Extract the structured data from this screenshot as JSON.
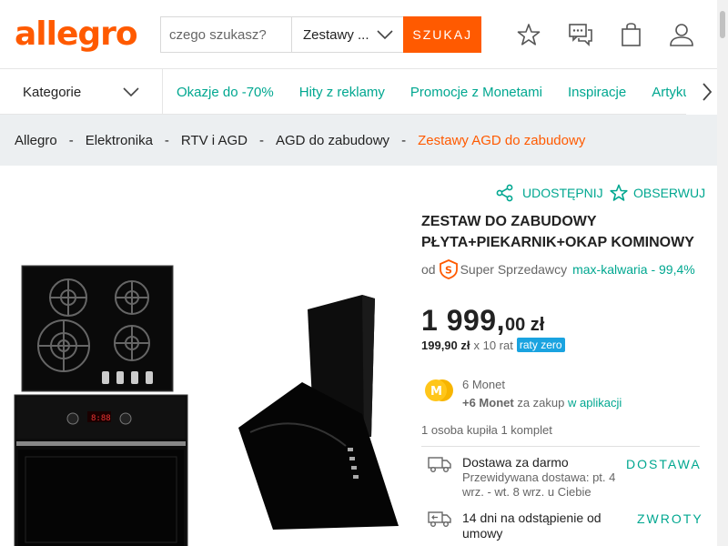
{
  "header": {
    "logo": "allegro",
    "search_placeholder": "czego szukasz?",
    "category_select": "Zestawy ...",
    "search_button": "SZUKAJ"
  },
  "nav": {
    "categories_label": "Kategorie",
    "links": [
      "Okazje do -70%",
      "Hity z reklamy",
      "Promocje z Monetami",
      "Inspiracje",
      "Artykuły"
    ]
  },
  "breadcrumb": {
    "items": [
      "Allegro",
      "Elektronika",
      "RTV i AGD",
      "AGD do zabudowy"
    ],
    "separator": "-",
    "current": "Zestawy AGD do zabudowy"
  },
  "product": {
    "share_label": "UDOSTĘPNIJ",
    "observe_label": "OBSERWUJ",
    "title_line1": "ZESTAW DO ZABUDOWY",
    "title_line2": "PŁYTA+PIEKARNIK+OKAP KOMINOWY",
    "seller_prefix": "od",
    "seller_badge": "Super Sprzedawcy",
    "seller_name": "max-kalwaria - 99,4%",
    "price_main": "1 999,",
    "price_decimal": "00 zł",
    "installment_amount": "199,90 zł",
    "installment_count": "x 10 rat",
    "installment_badge": "raty zero",
    "coins_label": "6 Monet",
    "coins_bonus": "+6 Monet",
    "coins_text": "za zakup",
    "coins_link": "w aplikacji",
    "bought": "1 osoba kupiła 1 komplet",
    "shipping_title": "Dostawa za darmo",
    "shipping_sub": "Przewidywana dostawa: pt. 4 wrz. - wt. 8 wrz. u Ciebie",
    "shipping_link": "DOSTAWA",
    "returns_title": "14 dni na odstąpienie od umowy",
    "returns_link": "ZWROTY"
  },
  "colors": {
    "brand": "#ff5a00",
    "link": "#00a790",
    "badge": "#1aa3e0"
  }
}
